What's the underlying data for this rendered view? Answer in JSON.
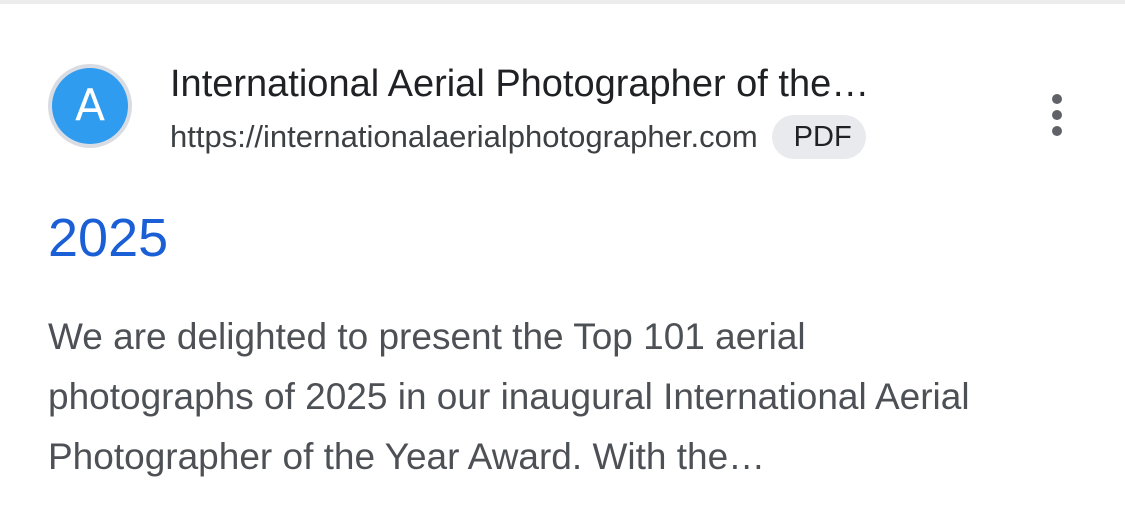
{
  "result": {
    "favicon_letter": "A",
    "site_name": "International Aerial Photographer of the…",
    "url": "https://internationalaerialphotographer.com",
    "badge": "PDF",
    "more_icon": "more-vert-icon",
    "title": "2025",
    "snippet": "We are delighted to present the Top 101 aerial photographs of 2025 in our inaugural International Aerial Photographer of the Year Award. With the…"
  },
  "colors": {
    "title_link": "#1a5fd6",
    "favicon_bg": "#2f9cef",
    "snippet_text": "#4d5156",
    "badge_bg": "#e8eaed"
  }
}
